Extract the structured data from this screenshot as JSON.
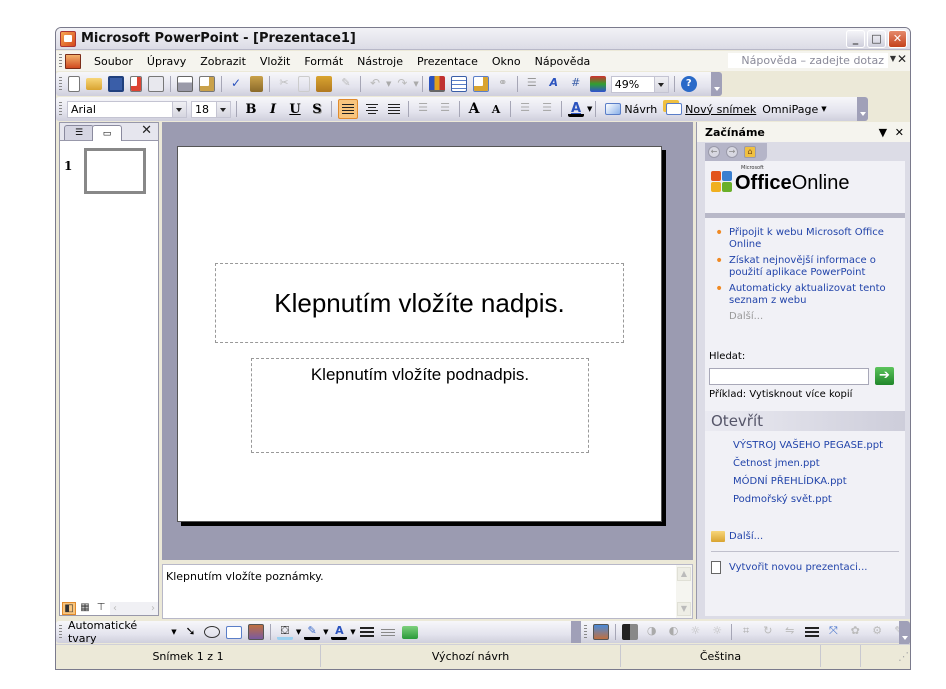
{
  "window": {
    "title": "Microsoft PowerPoint - [Prezentace1]",
    "controls": {
      "minimize": "minimize-icon",
      "maximize": "maximize-icon",
      "close": "close-icon"
    }
  },
  "menubar": {
    "items": [
      "Soubor",
      "Úpravy",
      "Zobrazit",
      "Vložit",
      "Formát",
      "Nástroje",
      "Prezentace",
      "Okno",
      "Nápověda"
    ],
    "help_placeholder": "Nápověda – zadejte dotaz"
  },
  "standard_toolbar": {
    "icons": [
      "new-icon",
      "open-icon",
      "save-icon",
      "permission-icon",
      "email-icon",
      "print-icon",
      "print-preview-icon",
      "spelling-icon",
      "research-icon",
      "cut-icon",
      "copy-icon",
      "paste-icon",
      "format-painter-icon",
      "undo-icon",
      "redo-icon",
      "insert-chart-icon",
      "insert-table-icon",
      "tables-borders-icon",
      "insert-hyperlink-icon",
      "expand-all-icon",
      "show-formatting-icon",
      "grid-icon",
      "color-grayscale-icon",
      "help-icon"
    ],
    "zoom": "49%"
  },
  "formatting_toolbar": {
    "font": "Arial",
    "font_size": "18",
    "bold": "B",
    "italic": "I",
    "underline": "U",
    "shadow": "S",
    "design_label": "Návrh",
    "new_slide_label": "Nový snímek",
    "omnipage_label": "OmniPage"
  },
  "left_pane": {
    "tabs": [
      "outline-tab",
      "slides-tab"
    ],
    "slide_number": "1"
  },
  "slide": {
    "title_placeholder": "Klepnutím vložíte nadpis.",
    "subtitle_placeholder": "Klepnutím vložíte podnadpis."
  },
  "notes": {
    "placeholder": "Klepnutím vložíte poznámky."
  },
  "task_pane": {
    "title": "Začínáme",
    "logo_small": "Microsoft",
    "logo_office": "Office",
    "logo_online": "Online",
    "links": [
      "Připojit k webu Microsoft Office Online",
      "Získat nejnovější informace o použití aplikace PowerPoint",
      "Automaticky aktualizovat tento seznam z webu"
    ],
    "more": "Další...",
    "search_label": "Hledat:",
    "search_value": "",
    "example": "Příklad:  Vytisknout více kopií",
    "open_header": "Otevřít",
    "files": [
      "VÝSTROJ VAŠEHO PEGASE.ppt",
      "Četnost jmen.ppt",
      "MÓDNÍ PŘEHLÍDKA.ppt",
      "Podmořský svět.ppt"
    ],
    "open_more": "Další...",
    "new_presentation": "Vytvořit novou prezentaci..."
  },
  "drawing_toolbar": {
    "autoshapes": "Automatické tvary"
  },
  "statusbar": {
    "slide": "Snímek 1 z 1",
    "design": "Výchozí návrh",
    "language": "Čeština"
  },
  "colors": {
    "accent": "#f8c57e",
    "link": "#2244aa",
    "workspace": "#9b9bb1"
  }
}
